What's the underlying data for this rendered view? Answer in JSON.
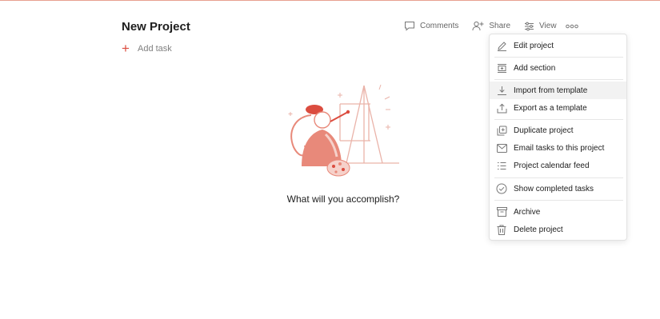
{
  "project": {
    "title": "New Project",
    "add_task_label": "Add task",
    "empty_state_text": "What will you accomplish?"
  },
  "header_actions": {
    "comments": "Comments",
    "share": "Share",
    "view": "View"
  },
  "menu": {
    "items": [
      {
        "label": "Edit project",
        "icon": "pencil-icon"
      },
      {
        "label": "Add section",
        "icon": "add-section-icon"
      },
      {
        "label": "Import from template",
        "icon": "download-icon"
      },
      {
        "label": "Export as a template",
        "icon": "upload-icon"
      },
      {
        "label": "Duplicate project",
        "icon": "duplicate-icon"
      },
      {
        "label": "Email tasks to this project",
        "icon": "email-icon"
      },
      {
        "label": "Project calendar feed",
        "icon": "list-icon"
      },
      {
        "label": "Show completed tasks",
        "icon": "check-circle-icon"
      },
      {
        "label": "Archive",
        "icon": "archive-icon"
      },
      {
        "label": "Delete project",
        "icon": "trash-icon"
      }
    ]
  },
  "colors": {
    "accent": "#db4c3f",
    "illustration": "#e8897a",
    "hover_bg": "#f2f2f2"
  }
}
